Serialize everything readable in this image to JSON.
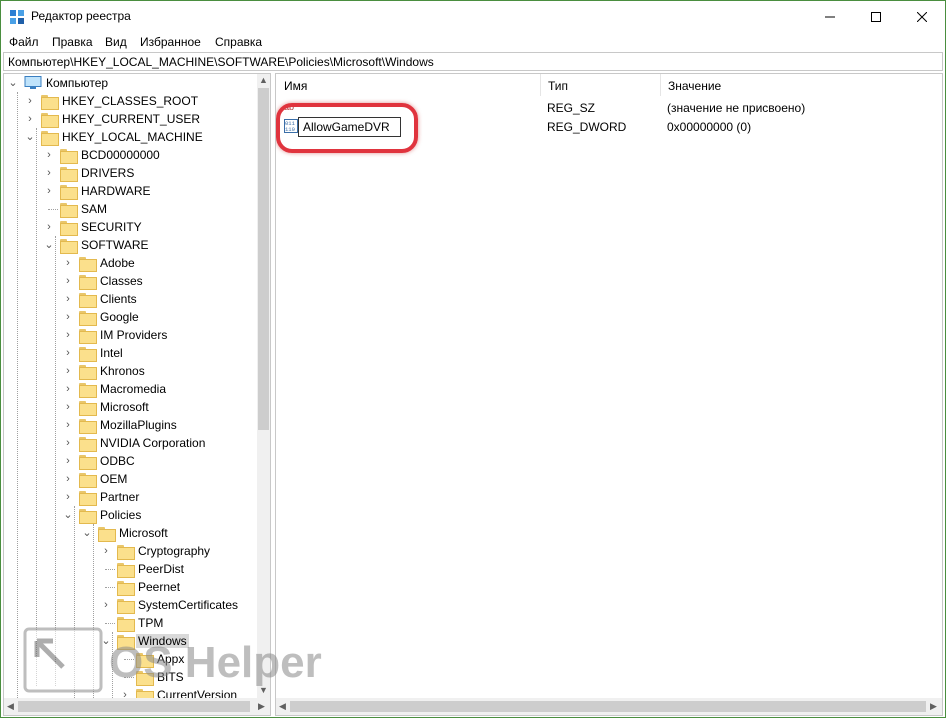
{
  "window": {
    "title": "Редактор реестра",
    "controls": {
      "minimize": "—",
      "maximize": "☐",
      "close": "✕"
    }
  },
  "menu": [
    "Файл",
    "Правка",
    "Вид",
    "Избранное",
    "Справка"
  ],
  "address": "Компьютер\\HKEY_LOCAL_MACHINE\\SOFTWARE\\Policies\\Microsoft\\Windows",
  "tree": {
    "root": "Компьютер",
    "items": [
      {
        "label": "HKEY_CLASSES_ROOT",
        "expanded": false,
        "selected": false
      },
      {
        "label": "HKEY_CURRENT_USER",
        "expanded": false,
        "selected": false
      },
      {
        "label": "HKEY_LOCAL_MACHINE",
        "expanded": true,
        "selected": false
      },
      {
        "label": "BCD00000000",
        "expanded": false,
        "selected": false
      },
      {
        "label": "DRIVERS",
        "expanded": false,
        "selected": false
      },
      {
        "label": "HARDWARE",
        "expanded": false,
        "selected": false
      },
      {
        "label": "SAM",
        "expanded": false,
        "selected": false
      },
      {
        "label": "SECURITY",
        "expanded": false,
        "selected": false
      },
      {
        "label": "SOFTWARE",
        "expanded": true,
        "selected": false
      },
      {
        "label": "Adobe",
        "expanded": false,
        "selected": false
      },
      {
        "label": "Classes",
        "expanded": false,
        "selected": false
      },
      {
        "label": "Clients",
        "expanded": false,
        "selected": false
      },
      {
        "label": "Google",
        "expanded": false,
        "selected": false
      },
      {
        "label": "IM Providers",
        "expanded": false,
        "selected": false
      },
      {
        "label": "Intel",
        "expanded": false,
        "selected": false
      },
      {
        "label": "Khronos",
        "expanded": false,
        "selected": false
      },
      {
        "label": "Macromedia",
        "expanded": false,
        "selected": false
      },
      {
        "label": "Microsoft",
        "expanded": false,
        "selected": false
      },
      {
        "label": "MozillaPlugins",
        "expanded": false,
        "selected": false
      },
      {
        "label": "NVIDIA Corporation",
        "expanded": false,
        "selected": false
      },
      {
        "label": "ODBC",
        "expanded": false,
        "selected": false
      },
      {
        "label": "OEM",
        "expanded": false,
        "selected": false
      },
      {
        "label": "Partner",
        "expanded": false,
        "selected": false
      },
      {
        "label": "Policies",
        "expanded": true,
        "selected": false
      },
      {
        "label": "Microsoft",
        "expanded": true,
        "selected": false
      },
      {
        "label": "Cryptography",
        "expanded": false,
        "selected": false
      },
      {
        "label": "PeerDist",
        "expanded": false,
        "selected": false
      },
      {
        "label": "Peernet",
        "expanded": false,
        "selected": false
      },
      {
        "label": "SystemCertificates",
        "expanded": false,
        "selected": false
      },
      {
        "label": "TPM",
        "expanded": false,
        "selected": false
      },
      {
        "label": "Windows",
        "expanded": true,
        "selected": true
      },
      {
        "label": "Appx",
        "expanded": false,
        "selected": false
      },
      {
        "label": "BITS",
        "expanded": false,
        "selected": false
      },
      {
        "label": "CurrentVersion",
        "expanded": false,
        "selected": false
      }
    ]
  },
  "list": {
    "columns": [
      "Имя",
      "Тип",
      "Значение"
    ],
    "rows": [
      {
        "name": "",
        "type": "REG_SZ",
        "value": "(значение не присвоено)"
      },
      {
        "name": "AllowGameDVR",
        "type": "REG_DWORD",
        "value": "0x00000000 (0)"
      }
    ],
    "rename_value": "AllowGameDVR"
  },
  "watermark": "OS Helper",
  "colors": {
    "highlight": "#e0343e",
    "folder": "#fbe08c",
    "selection": "#d9d9d9",
    "window_border": "#4a8e3f"
  }
}
